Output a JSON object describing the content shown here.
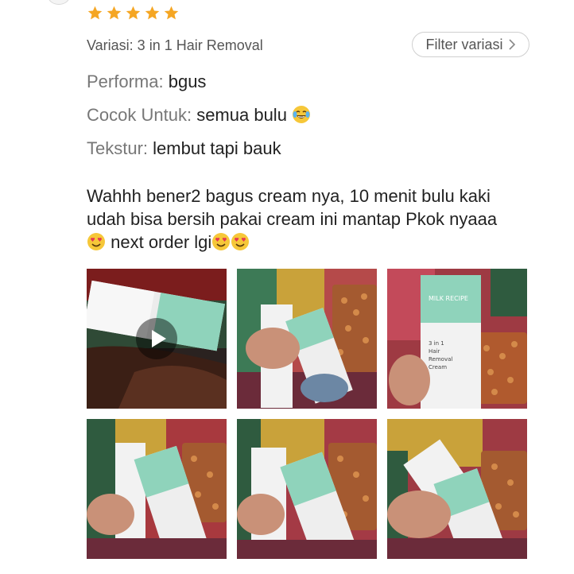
{
  "review": {
    "rating": 5,
    "variation_text": "Variasi: 3 in 1 Hair Removal",
    "filter_label": "Filter variasi",
    "attributes": [
      {
        "key": "Performa:",
        "value": "bgus",
        "emoji": ""
      },
      {
        "key": "Cocok Untuk:",
        "value": "semua bulu",
        "emoji": "face-with-tears-of-joy"
      },
      {
        "key": "Tekstur:",
        "value": "lembut tapi bauk",
        "emoji": ""
      }
    ],
    "body_line1": "Wahhh bener2 bagus cream nya, 10 menit bulu kaki",
    "body_line2": "udah bisa bersih pakai cream ini mantap Pkok nyaaa",
    "body_line3": "next order lgi",
    "media": [
      {
        "kind": "video",
        "alt": "video thumbnail"
      },
      {
        "kind": "photo",
        "alt": "photo 1"
      },
      {
        "kind": "photo",
        "alt": "photo 2"
      },
      {
        "kind": "photo",
        "alt": "photo 3"
      },
      {
        "kind": "photo",
        "alt": "photo 4"
      },
      {
        "kind": "photo",
        "alt": "photo 5"
      }
    ],
    "product_label": {
      "brand": "MILK RECIPE",
      "name_l1": "3 in 1",
      "name_l2": "Hair",
      "name_l3": "Removal",
      "name_l4": "Cream"
    }
  },
  "colors": {
    "star": "#f5a623",
    "chip_border": "#cfcfcf",
    "text_primary": "#222222",
    "text_secondary": "#777777",
    "tube_mint": "#8fd3bb",
    "tube_white": "#eeeeee"
  },
  "icons": {
    "star": "star-icon",
    "chevron": "chevron-right-icon",
    "play": "play-icon",
    "laugh": "face-with-tears-of-joy",
    "love": "smiling-face-with-heart-eyes"
  }
}
